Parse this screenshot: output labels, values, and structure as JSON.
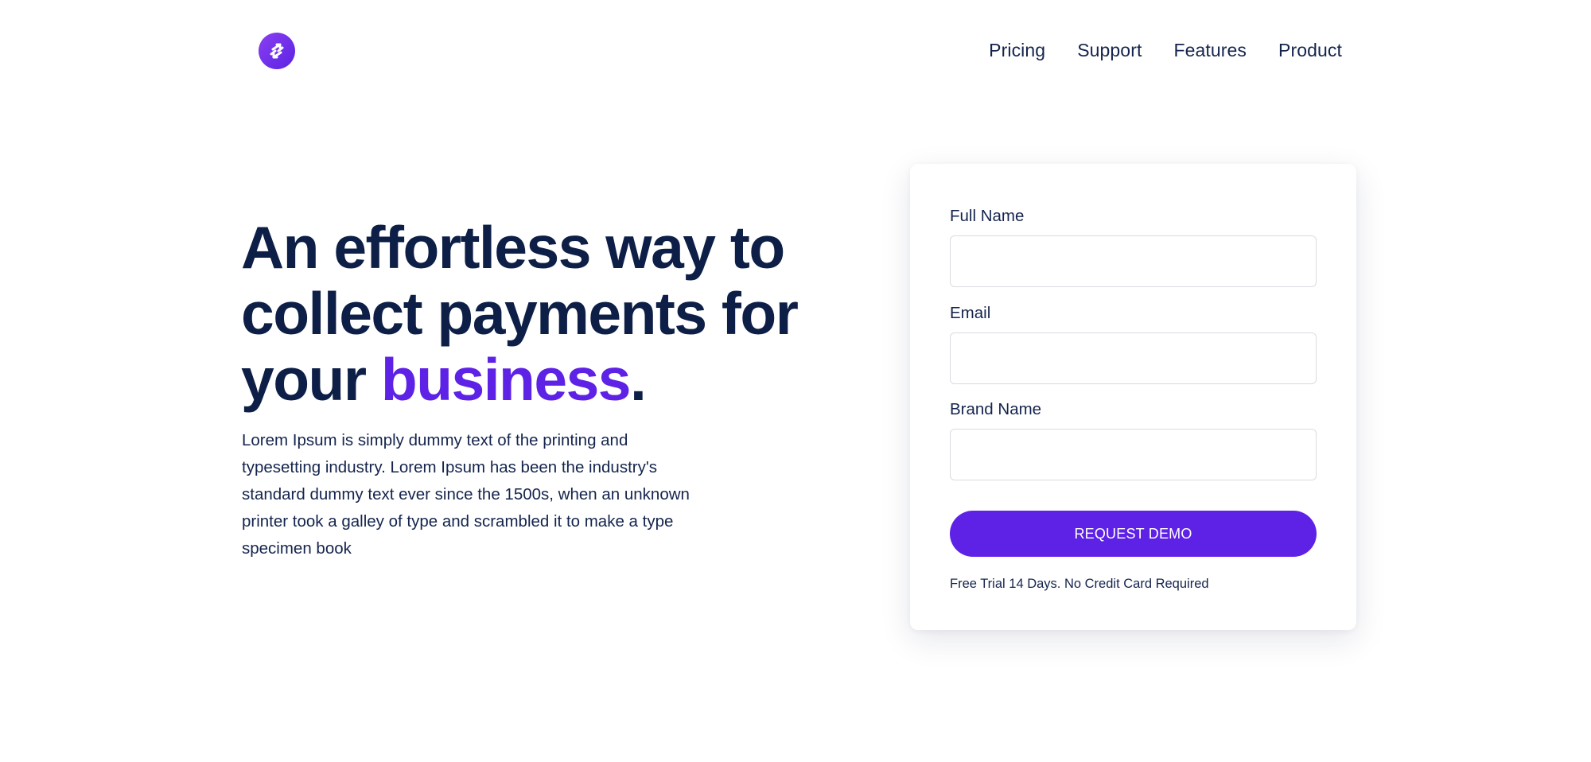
{
  "header": {
    "logo_icon": "swap-arrows-icon",
    "nav": [
      {
        "label": "Pricing"
      },
      {
        "label": "Support"
      },
      {
        "label": "Features"
      },
      {
        "label": "Product"
      }
    ]
  },
  "hero": {
    "title_line1": "An effortless way to",
    "title_line2": "collect payments for",
    "title_line3_prefix": "your ",
    "title_accent": "business",
    "title_suffix": ".",
    "description": "Lorem Ipsum is simply dummy text of the printing and typesetting industry. Lorem Ipsum has been the industry's standard dummy text ever since the 1500s, when an unknown printer took a galley of type and scrambled it to make a type specimen book"
  },
  "form": {
    "fields": [
      {
        "label": "Full Name",
        "value": "",
        "placeholder": ""
      },
      {
        "label": "Email",
        "value": "",
        "placeholder": ""
      },
      {
        "label": "Brand Name",
        "value": "",
        "placeholder": ""
      }
    ],
    "submit_label": "REQUEST DEMO",
    "note": "Free Trial 14 Days. No Credit Card Required"
  },
  "colors": {
    "accent": "#5e22e6",
    "heading": "#0d1f47",
    "text": "#14244d",
    "input_border": "#d9dbe1"
  }
}
